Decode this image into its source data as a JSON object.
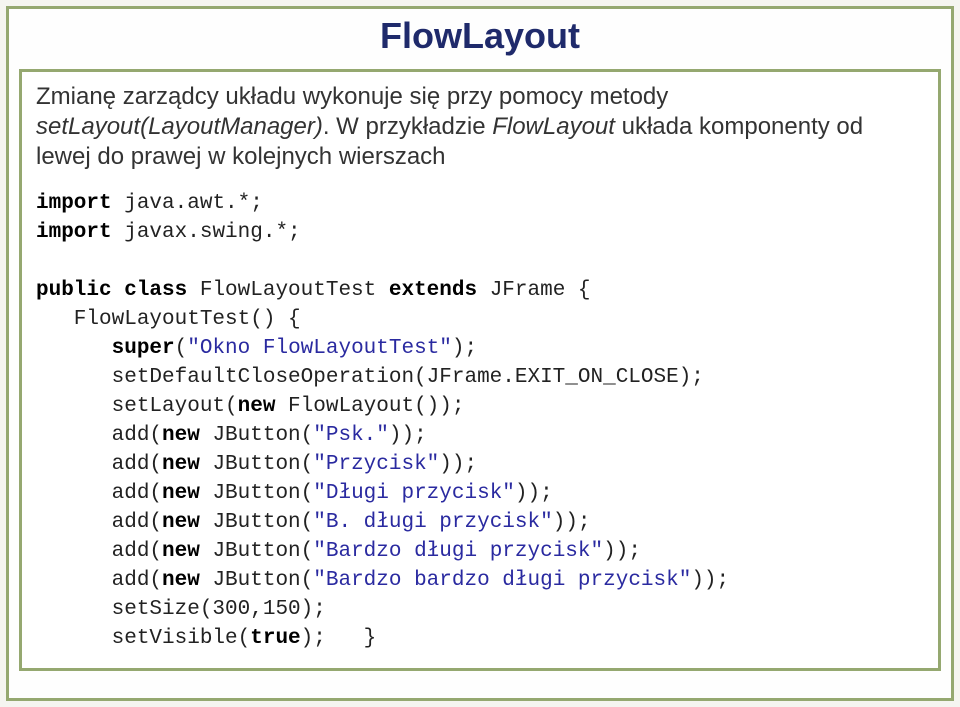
{
  "title": "FlowLayout",
  "intro_part1": "Zmianę zarządcy układu wykonuje się przy pomocy metody ",
  "intro_em": "setLayout(LayoutManager)",
  "intro_part2": ". W przykładzie ",
  "intro_em2": "FlowLayout",
  "intro_part3": " układa komponenty od lewej do prawej w kolejnych wierszach",
  "code": {
    "l1a": "import",
    "l1b": " java.awt.*;",
    "l2a": "import",
    "l2b": " javax.swing.*;",
    "l3": "",
    "l4a": "public class",
    "l4b": " FlowLayoutTest ",
    "l4c": "extends",
    "l4d": " JFrame {",
    "l5": "   FlowLayoutTest() {",
    "l6a": "      ",
    "l6b": "super",
    "l6c": "(",
    "l6d": "\"Okno FlowLayoutTest\"",
    "l6e": ");",
    "l7": "      setDefaultCloseOperation(JFrame.EXIT_ON_CLOSE);",
    "l8a": "      setLayout(",
    "l8b": "new",
    "l8c": " FlowLayout());",
    "l9a": "      add(",
    "l9b": "new",
    "l9c": " JButton(",
    "l9d": "\"Psk.\"",
    "l9e": "));",
    "l10a": "      add(",
    "l10b": "new",
    "l10c": " JButton(",
    "l10d": "\"Przycisk\"",
    "l10e": "));",
    "l11a": "      add(",
    "l11b": "new",
    "l11c": " JButton(",
    "l11d": "\"Długi przycisk\"",
    "l11e": "));",
    "l12a": "      add(",
    "l12b": "new",
    "l12c": " JButton(",
    "l12d": "\"B. długi przycisk\"",
    "l12e": "));",
    "l13a": "      add(",
    "l13b": "new",
    "l13c": " JButton(",
    "l13d": "\"Bardzo długi przycisk\"",
    "l13e": "));",
    "l14a": "      add(",
    "l14b": "new",
    "l14c": " JButton(",
    "l14d": "\"Bardzo bardzo długi przycisk\"",
    "l14e": "));",
    "l15": "      setSize(300,150);",
    "l16a": "      setVisible(",
    "l16b": "true",
    "l16c": ");   }"
  }
}
